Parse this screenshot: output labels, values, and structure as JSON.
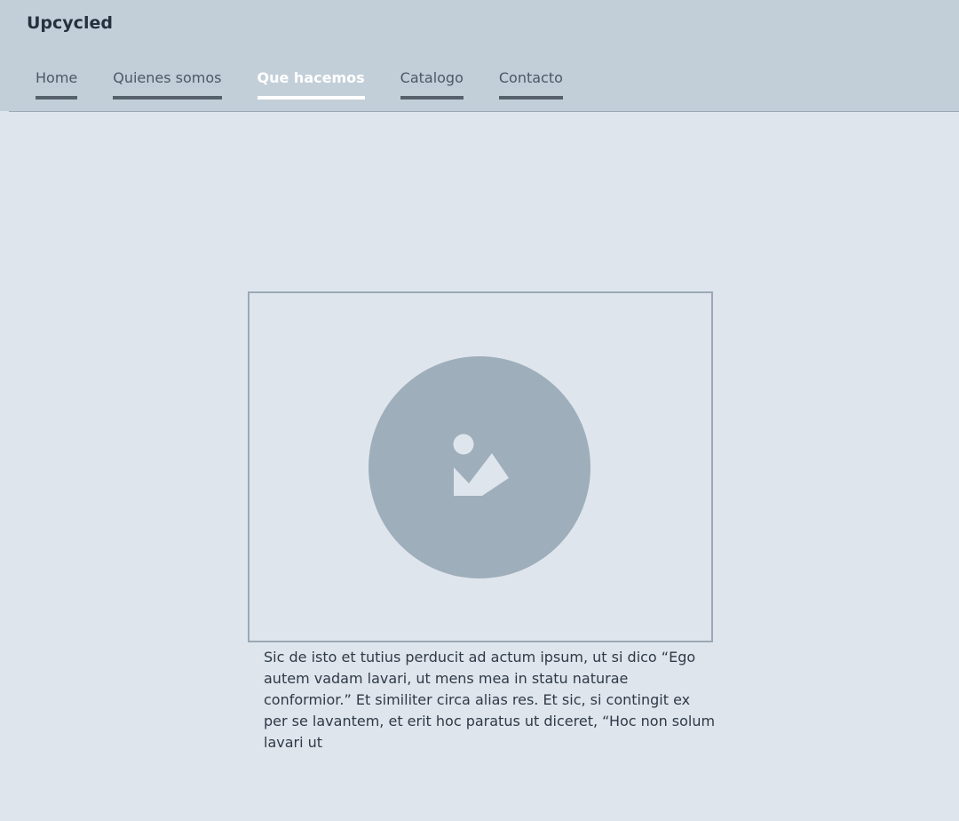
{
  "header": {
    "brand": "Upcycled",
    "nav": [
      {
        "label": "Home",
        "active": false
      },
      {
        "label": "Quienes somos",
        "active": false
      },
      {
        "label": "Que hacemos",
        "active": true
      },
      {
        "label": "Catalogo",
        "active": false
      },
      {
        "label": "Contacto",
        "active": false
      }
    ]
  },
  "main": {
    "image": {
      "icon": "image-placeholder-icon"
    },
    "caption": "Sic de isto et tutius perducit ad actum ipsum, ut si dico “Ego autem vadam lavari, ut mens mea in statu naturae conformior.” Et similiter circa alias res. Et sic, si contingit ex per se lavantem, et erit hoc paratus ut diceret, “Hoc non solum lavari ut"
  },
  "colors": {
    "header_bg": "#c3cfd8",
    "page_bg": "#dfe5ed",
    "icon_fill": "#9eaeba",
    "active_tab": "#ffffff",
    "tab_underline": "#56616c"
  }
}
